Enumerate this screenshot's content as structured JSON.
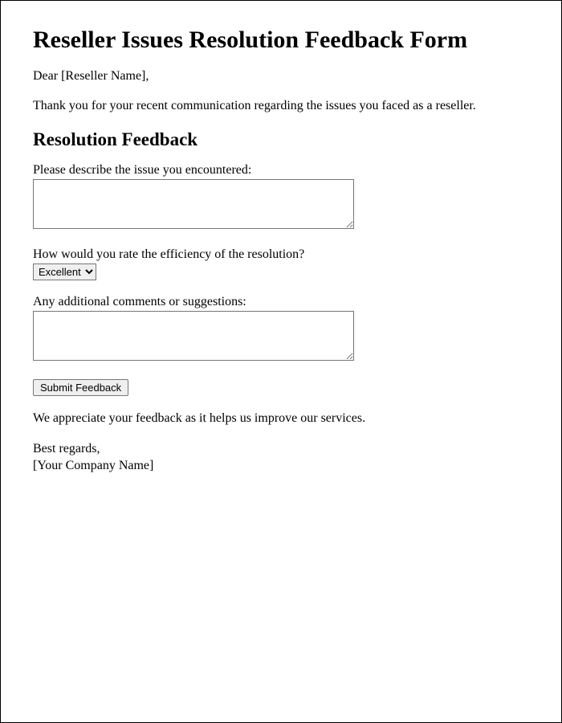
{
  "title": "Reseller Issues Resolution Feedback Form",
  "greeting": "Dear [Reseller Name],",
  "intro": "Thank you for your recent communication regarding the issues you faced as a reseller.",
  "section_heading": "Resolution Feedback",
  "fields": {
    "issue": {
      "label": "Please describe the issue you encountered:",
      "value": ""
    },
    "rating": {
      "label": "How would you rate the efficiency of the resolution?",
      "selected": "Excellent"
    },
    "comments": {
      "label": "Any additional comments or suggestions:",
      "value": ""
    }
  },
  "submit_label": "Submit Feedback",
  "appreciation": "We appreciate your feedback as it helps us improve our services.",
  "closing": {
    "regards": "Best regards,",
    "company": "[Your Company Name]"
  }
}
